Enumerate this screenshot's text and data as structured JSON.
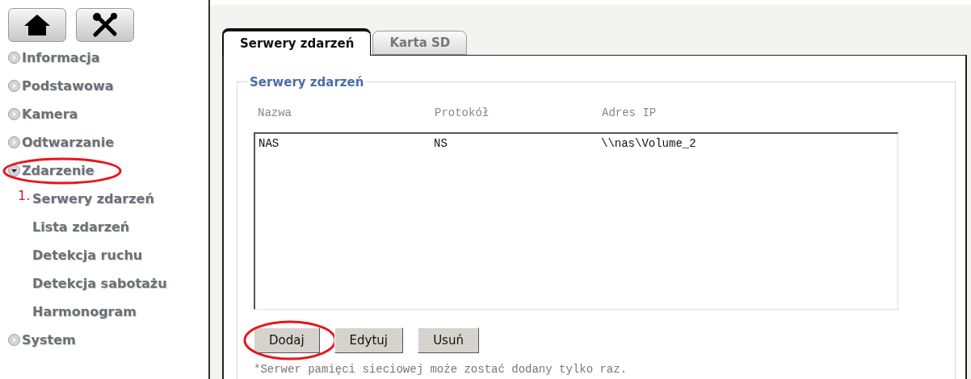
{
  "toolbar": [
    {
      "kind": "home"
    },
    {
      "kind": "tools"
    }
  ],
  "nav": [
    {
      "label": "Informacja",
      "expanded": false,
      "circled": false
    },
    {
      "label": "Podstawowa",
      "expanded": false,
      "circled": false
    },
    {
      "label": "Kamera",
      "expanded": false,
      "circled": false
    },
    {
      "label": "Odtwarzanie",
      "expanded": false,
      "circled": false
    },
    {
      "label": "Zdarzenie",
      "expanded": true,
      "circled": true,
      "children": [
        {
          "label": "Serwery zdarzeń",
          "marker": "1."
        },
        {
          "label": "Lista zdarzeń"
        },
        {
          "label": "Detekcja ruchu"
        },
        {
          "label": "Detekcja sabotażu"
        },
        {
          "label": "Harmonogram"
        }
      ]
    },
    {
      "label": "System",
      "expanded": false,
      "circled": false
    }
  ],
  "tabs": [
    {
      "label": "Serwery zdarzeń",
      "selected": true
    },
    {
      "label": "Karta SD",
      "selected": false
    }
  ],
  "group": {
    "title": "Serwery zdarzeń",
    "columns": [
      "Nazwa",
      "Protokół",
      "Adres IP"
    ],
    "rows": [
      {
        "cells": [
          "NAS",
          "NS",
          "\\\\nas\\Volume_2"
        ]
      }
    ]
  },
  "buttons": [
    {
      "label": "Dodaj",
      "circled": true
    },
    {
      "label": "Edytuj",
      "circled": false
    },
    {
      "label": "Usuń",
      "circled": false
    }
  ],
  "note": "*Serwer pamięci sieciowej może zostać dodany tylko raz."
}
